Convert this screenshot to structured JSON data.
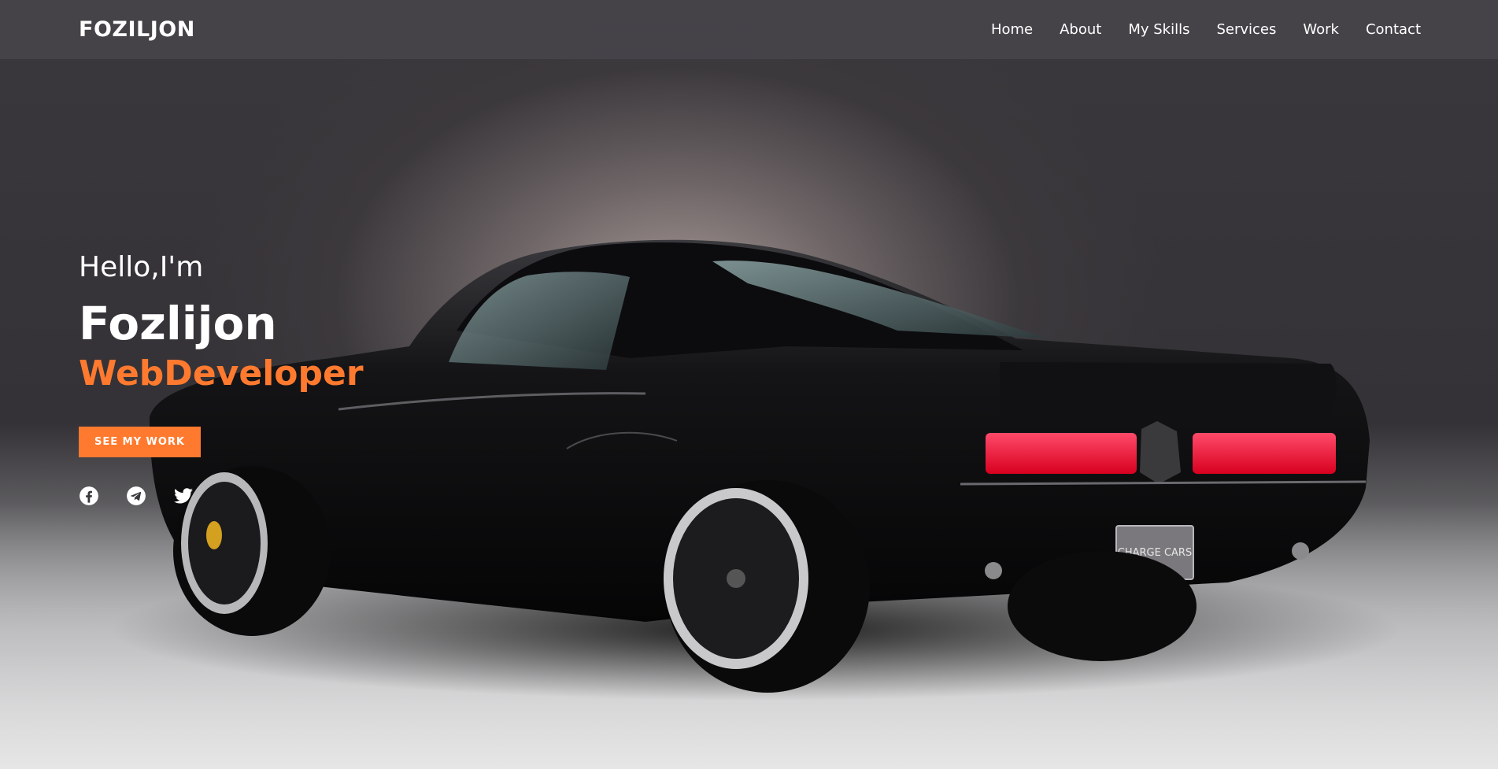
{
  "brand": {
    "logo": "FOZILJON"
  },
  "nav": {
    "items": [
      {
        "label": "Home"
      },
      {
        "label": "About"
      },
      {
        "label": "My Skills"
      },
      {
        "label": "Services"
      },
      {
        "label": "Work"
      },
      {
        "label": "Contact"
      }
    ]
  },
  "hero": {
    "greeting": "Hello,I'm",
    "name": "Fozlijon",
    "role": "WebDeveloper",
    "cta_label": "SEE MY WORK",
    "plate_text": "CHARGE CARS"
  },
  "socials": [
    {
      "icon": "facebook-icon"
    },
    {
      "icon": "telegram-icon"
    },
    {
      "icon": "twitter-icon"
    }
  ],
  "colors": {
    "accent": "#ff7a2f",
    "navbar_bg": "#46444a",
    "text": "#ffffff",
    "tail_light": "#ff1a3c"
  }
}
